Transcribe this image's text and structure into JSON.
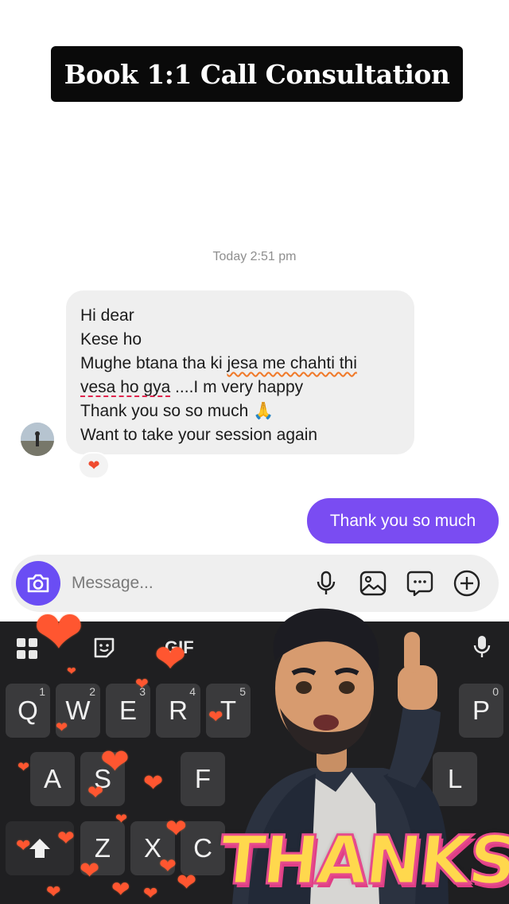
{
  "banner": {
    "title": "Book 1:1 Call Consultation"
  },
  "chat": {
    "timestamp": "Today 2:51 pm",
    "incoming": {
      "line1": "Hi dear",
      "line2": "Kese ho",
      "line3_plain": "Mughe btana tha ki ",
      "line3_marked": "jesa me chahti thi",
      "line4_marked": "vesa ho gya",
      "line4_plain": " ....I m very happy",
      "line5": "Thank you so so much 🙏",
      "line6": "Want to take your session again",
      "reaction": "❤"
    },
    "outgoing": {
      "text": "Thank you so much"
    }
  },
  "composer": {
    "placeholder": "Message...",
    "icons": [
      "camera-icon",
      "microphone-icon",
      "gallery-icon",
      "sticker-chat-icon",
      "plus-icon"
    ]
  },
  "keyboard": {
    "toolbar_partial": "GIF",
    "row1": [
      {
        "label": "Q",
        "hint": "1"
      },
      {
        "label": "W",
        "hint": "2"
      },
      {
        "label": "E",
        "hint": "3"
      },
      {
        "label": "R",
        "hint": "4"
      },
      {
        "label": "T",
        "hint": "5"
      },
      {
        "label": "P",
        "hint": "0"
      }
    ],
    "row2": [
      "A",
      "S",
      "F",
      "L"
    ],
    "row3": [
      "Z",
      "X",
      "C"
    ],
    "colors": {
      "key": "#3a3a3c",
      "background": "#1f1f21"
    }
  },
  "overlay": {
    "sticker_text": "THANKS!",
    "heart_color": "#ff5630"
  },
  "colors": {
    "accent": "#7a4cf2",
    "camera": "#6a4df4",
    "bubble_in": "#efefef"
  }
}
